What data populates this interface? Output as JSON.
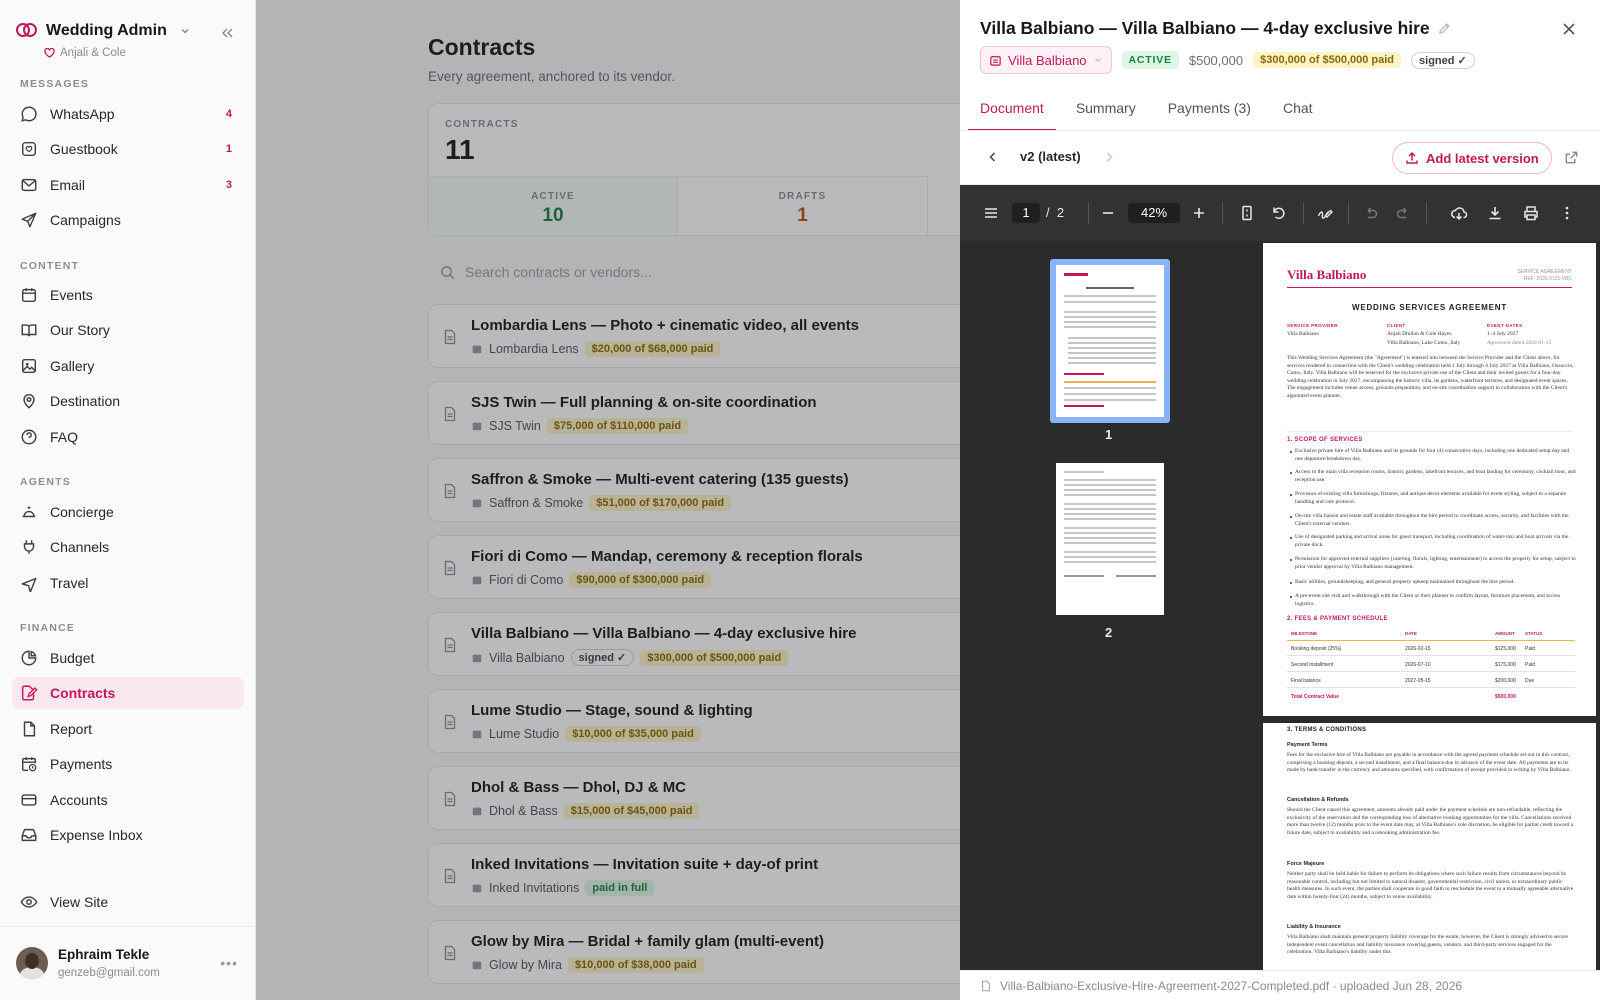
{
  "workspace": {
    "name": "Wedding Admin",
    "couple": "Anjali & Cole"
  },
  "sidebar": {
    "sections": {
      "messages": "MESSAGES",
      "content": "CONTENT",
      "agents": "AGENTS",
      "finance": "FINANCE"
    },
    "messages": [
      {
        "label": "WhatsApp",
        "count": "4"
      },
      {
        "label": "Guestbook",
        "count": "1"
      },
      {
        "label": "Email",
        "count": "3"
      },
      {
        "label": "Campaigns",
        "count": ""
      }
    ],
    "content": [
      {
        "label": "Events"
      },
      {
        "label": "Our Story"
      },
      {
        "label": "Gallery"
      },
      {
        "label": "Destination"
      },
      {
        "label": "FAQ"
      }
    ],
    "agents": [
      {
        "label": "Concierge"
      },
      {
        "label": "Channels"
      },
      {
        "label": "Travel"
      }
    ],
    "finance": [
      {
        "label": "Budget"
      },
      {
        "label": "Contracts"
      },
      {
        "label": "Report"
      },
      {
        "label": "Payments"
      },
      {
        "label": "Accounts"
      },
      {
        "label": "Expense Inbox"
      }
    ],
    "view_site": "View Site",
    "user": {
      "name": "Ephraim Tekle",
      "email": "genzeb@gmail.com"
    }
  },
  "main": {
    "title": "Contracts",
    "subtitle": "Every agreement, anchored to its vendor.",
    "stats": {
      "contracts_label": "CONTRACTS",
      "contracts_value": "11",
      "active_label": "ACTIVE",
      "active_value": "10",
      "drafts_label": "DRAFTS",
      "drafts_value": "1"
    },
    "search_placeholder": "Search contracts or vendors...",
    "rows": [
      {
        "title": "Lombardia Lens — Photo + cinematic video, all events",
        "vendor": "Lombardia Lens",
        "signed": "",
        "paid": "$20,000 of $68,000 paid"
      },
      {
        "title": "SJS Twin — Full planning & on-site coordination",
        "vendor": "SJS Twin",
        "signed": "",
        "paid": "$75,000 of $110,000 paid"
      },
      {
        "title": "Saffron & Smoke — Multi-event catering (135 guests)",
        "vendor": "Saffron & Smoke",
        "signed": "",
        "paid": "$51,000 of $170,000 paid"
      },
      {
        "title": "Fiori di Como — Mandap, ceremony & reception florals",
        "vendor": "Fiori di Como",
        "signed": "",
        "paid": "$90,000 of $300,000 paid"
      },
      {
        "title": "Villa Balbiano — Villa Balbiano — 4-day exclusive hire",
        "vendor": "Villa Balbiano",
        "signed": "signed ✓",
        "paid": "$300,000 of $500,000 paid"
      },
      {
        "title": "Lume Studio — Stage, sound & lighting",
        "vendor": "Lume Studio",
        "signed": "",
        "paid": "$10,000 of $35,000 paid"
      },
      {
        "title": "Dhol & Bass — Dhol, DJ & MC",
        "vendor": "Dhol & Bass",
        "signed": "",
        "paid": "$15,000 of $45,000 paid"
      },
      {
        "title": "Inked Invitations — Invitation suite + day-of print",
        "vendor": "Inked Invitations",
        "signed": "",
        "paid": "paid in full"
      },
      {
        "title": "Glow by Mira — Bridal + family glam (multi-event)",
        "vendor": "Glow by Mira",
        "signed": "",
        "paid": "$10,000 of $38,000 paid"
      }
    ]
  },
  "drawer": {
    "title": "Villa Balbiano — Villa Balbiano — 4-day exclusive hire",
    "vendor": "Villa Balbiano",
    "status": "ACTIVE",
    "amount": "$500,000",
    "paid": "$300,000 of $500,000 paid",
    "signed": "signed ✓",
    "tabs": [
      "Document",
      "Summary",
      "Payments (3)",
      "Chat"
    ],
    "version": "v2 (latest)",
    "add_version": "Add latest version",
    "pdf": {
      "page": "1",
      "of": "/",
      "pages": "2",
      "zoom": "42%",
      "thumb_labels": [
        "1",
        "2"
      ]
    },
    "doc": {
      "brand": "Villa Balbiano",
      "tr1": "SERVICE AGREEMENT",
      "tr2": "REF: 2026-0115-VBC",
      "heading": "WEDDING SERVICES AGREEMENT",
      "provider_label": "SERVICE PROVIDER",
      "provider": "Villa Balbiano",
      "client_label": "CLIENT",
      "client": "Anjali Dhillon & Cole Hayes",
      "client_place": "Villa Balbiano, Lake Como, Italy",
      "dates_label": "EVENT DATES",
      "dates": "1–4 July 2027",
      "agreement_date": "Agreement dated 2026-01-15",
      "intro": "This Wedding Services Agreement (the \"Agreement\") is entered into between the Service Provider and the Client above, for services rendered in connection with the Client's wedding celebration held 1 July through 4 July 2027 at Villa Balbiano, Ossuccio, Como, Italy. Villa Balbiano will be reserved for the exclusive private use of the Client and their invited guests for a four-day wedding celebration in July 2027, encompassing the historic villa, its gardens, waterfront terraces, and designated event spaces. The engagement includes venue access, grounds preparation, and on-site coordination support in collaboration with the Client's appointed event planner.",
      "s1": "1. SCOPE OF SERVICES",
      "bullets": [
        "Exclusive private hire of Villa Balbiano and its grounds for four (4) consecutive days, including one dedicated setup day and one departure/breakdown day.",
        "Access to the main villa reception rooms, historic gardens, lakefront terraces, and boat landing for ceremony, cocktail hour, and reception use.",
        "Provision of existing villa furnishings, fixtures, and antique decor elements available for event styling, subject to a separate handling and care protocol.",
        "On-site villa liaison and estate staff available throughout the hire period to coordinate access, security, and facilities with the Client's external vendors.",
        "Use of designated parking and arrival areas for guest transport, including coordination of water-taxi and boat arrivals via the private dock.",
        "Permission for approved external suppliers (catering, florals, lighting, entertainment) to access the property for setup, subject to prior vendor approval by Villa Balbiano management.",
        "Basic utilities, groundskeeping, and general property upkeep maintained throughout the hire period.",
        "A pre-event site visit and walkthrough with the Client or their planner to confirm layout, furniture placement, and access logistics."
      ],
      "s2": "2. FEES & PAYMENT SCHEDULE",
      "table_head": [
        "MILESTONE",
        "DATE",
        "AMOUNT",
        "STATUS"
      ],
      "table_rows": [
        [
          "Booking deposit (25%)",
          "2026-02-15",
          "$125,000",
          "Paid"
        ],
        [
          "Second installment",
          "2026-07-10",
          "$175,000",
          "Paid"
        ],
        [
          "Final balance",
          "2027-05-15",
          "$200,000",
          "Due"
        ]
      ],
      "total_label": "Total Contract Value",
      "total": "$500,000",
      "s3": "3. TERMS & CONDITIONS",
      "payment_terms": "Payment Terms",
      "payment_text": "Fees for the exclusive hire of Villa Balbiano are payable in accordance with the agreed payment schedule set out in this contract, comprising a booking deposit, a second installment, and a final balance due in advance of the event date. All payments are to be made by bank transfer in the currency and amounts specified, with confirmation of receipt provided in writing by Villa Balbiano.",
      "cancel_title": "Cancellation & Refunds",
      "cancel_text": "Should the Client cancel this agreement, amounts already paid under the payment schedule are non-refundable, reflecting the exclusivity of the reservation and the corresponding loss of alternative booking opportunities for the villa. Cancellations received more than twelve (12) months prior to the event date may, at Villa Balbiano's sole discretion, be eligible for partial credit toward a future date, subject to availability and a rebooking administration fee.",
      "force_title": "Force Majeure",
      "force_text": "Neither party shall be held liable for failure to perform its obligations where such failure results from circumstances beyond its reasonable control, including but not limited to natural disaster, governmental restriction, civil unrest, or extraordinary public health measures. In such event, the parties shall cooperate in good faith to reschedule the event to a mutually agreeable alternative date within twenty-four (24) months, subject to venue availability.",
      "liab_title": "Liability & Insurance",
      "liab_text": "Villa Balbiano shall maintain general property liability coverage for the estate; however, the Client is strongly advised to secure independent event cancellation and liability insurance covering guests, vendors, and third-party services engaged for the celebration. Villa Balbiano's liability under this"
    },
    "footer": "Villa-Balbiano-Exclusive-Hire-Agreement-2027-Completed.pdf · uploaded Jun 28, 2026"
  },
  "colors": {
    "accent": "#c2185b",
    "active": "#17803d",
    "drafts": "#b45309",
    "paid_pill_bg": "#fdf3c7",
    "viewer_bg": "#2b2b2b"
  }
}
